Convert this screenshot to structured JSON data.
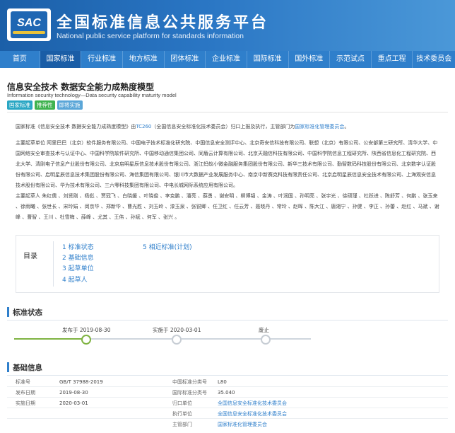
{
  "header": {
    "logo": "SAC",
    "title": "全国标准信息公共服务平台",
    "subtitle": "National public service platform  for standards information"
  },
  "nav": [
    "首页",
    "国家标准",
    "行业标准",
    "地方标准",
    "团体标准",
    "企业标准",
    "国际标准",
    "国外标准",
    "示范试点",
    "重点工程",
    "技术委员会"
  ],
  "standard": {
    "title_cn": "信息安全技术 数据安全能力成熟度模型",
    "title_en": "Information security technology—Data security capability maturity model",
    "badges": [
      "国家标准",
      "推荐性",
      "即将实施"
    ],
    "intro": {
      "prefix": "国家标准《信息安全技术 数据安全能力成熟度模型》由",
      "tc": "TC260",
      "mid": "（全国信息安全标准化技术委员会）归口上报及执行，主管部门为",
      "dept": "国家标准化管理委员会",
      "suffix": "。"
    },
    "drafting_units": "主要起草单位 阿里巴巴（北京）软件服务有限公司、中国电子技术标准化研究院、中国信息安全测评中心、北京奇安信科技有限公司、联想（北京）有限公司、公安部第三研究所、清华大学、中国网络安全审查技术与认证中心、中国科学院软件研究所、中国移动通信集团公司、同盾云计算有限公司、北京天融信科技有限公司、中国科学院信息工程研究所、陕西省信息化工程研究院、西北大学、清刚电子信息产业股份有限公司、北京启明星辰信息技术股份有限公司、浙江蚂蚁小微金融服务集团股份有限公司、新华三技术有限公司、勤智数码科技股份有限公司、北京数字认证股份有限公司、启明星辰信息技术集团股份有限公司、海信集团有限公司、银川市大数据产业发展服务中心、南京中新赛克科技有限责任公司、北京启明星辰信息安全技术有限公司、上海观安信息技术股份有限公司、华为技术有限公司、三六零科技集团有限公司、中电长城网际系统应用有限公司。",
    "drafters": "主要起草人 朱红儒 、刘贤刚 、杨彪 、贾冠飞 、白晓媛 、叶晓俊 、李克鹏 、潘亮 、薛勇 、谢安明 、柳博韬 、金涛 、叶润国 、孙明亮 、张宇光 、徐硕瑾 、杜跃进 、陈舒芳 、何鹏 、张玉来 、徐雨曦 、张世长 、宋玲娟 、闵京华 、郑新华 、曹光胜 、刘玉岭 、漆玉泉 、张锐卿 、任卫红 、任云芳 、聂晓丹 、常玲 、赵晖 、陈大江 、唐湘宁 、孙健 、李正 、孙蕾 、赵红 、马斌 、谢峰 、曹智 、王川 、杜雪梅 、薛峰 、尤其 、王伟 、孙斌 、何军 、张兴 。",
    "toc_label": "目录",
    "toc": [
      {
        "num": "1",
        "label": "标准状态"
      },
      {
        "num": "2",
        "label": "基础信息"
      },
      {
        "num": "3",
        "label": "起草单位"
      },
      {
        "num": "4",
        "label": "起草人"
      },
      {
        "num": "5",
        "label": "相近标准(计划)"
      }
    ],
    "status_section": "标准状态",
    "timeline": [
      {
        "label": "发布于 2019-08-30",
        "done": true
      },
      {
        "label": "实施于 2020-03-01",
        "done": false
      },
      {
        "label": "废止",
        "done": false
      }
    ],
    "basic_section": "基础信息",
    "basic_left": [
      {
        "k": "标准号",
        "v": "GB/T 37988-2019"
      },
      {
        "k": "发布日期",
        "v": "2019-08-30"
      },
      {
        "k": "实施日期",
        "v": "2020-03-01"
      }
    ],
    "basic_right": [
      {
        "k": "中国标准分类号",
        "v": "L80"
      },
      {
        "k": "国际标准分类号",
        "v": "35.040"
      },
      {
        "k": "归口单位",
        "v": "全国信息安全标准化技术委员会"
      },
      {
        "k": "执行单位",
        "v": "全国信息安全标准化技术委员会"
      },
      {
        "k": "主管部门",
        "v": "国家标准化管理委员会"
      }
    ]
  }
}
